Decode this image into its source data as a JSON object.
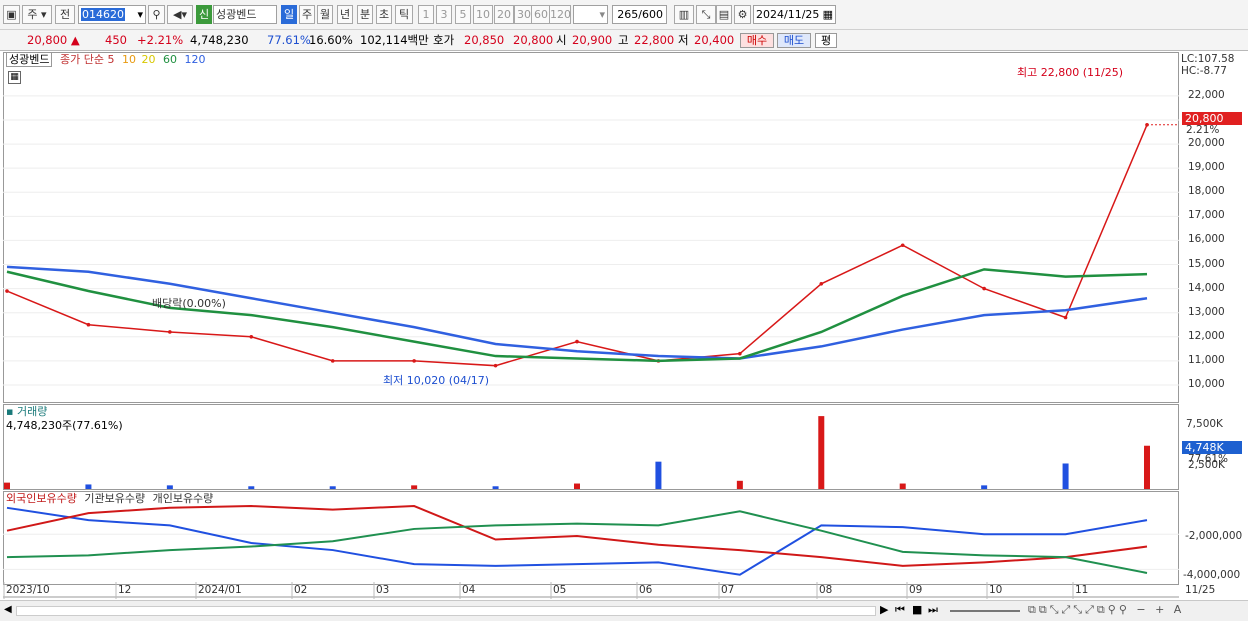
{
  "toolbar": {
    "market_type": "주",
    "prev_label": "전",
    "stock_code": "014620",
    "stock_badge": "신",
    "stock_name": "성광벤드",
    "periods": [
      "일",
      "주",
      "월",
      "년",
      "분",
      "초",
      "틱"
    ],
    "active_period": "일",
    "intervals": [
      "1",
      "3",
      "5",
      "10",
      "20",
      "30",
      "60",
      "120"
    ],
    "count": "265",
    "count_total": "/600",
    "date": "2024/11/25"
  },
  "quote": {
    "price": "20,800",
    "change": "450",
    "change_pct": "+2.21%",
    "volume": "4,748,230",
    "vol_ratio": "77.61%",
    "turnover": "16.60%",
    "amount": "102,114백만",
    "bid_label": "호가",
    "bid": "20,850",
    "ask": "20,800",
    "open_label": "시",
    "open": "20,900",
    "high_label": "고",
    "high": "22,800",
    "low_label": "저",
    "low": "20,400",
    "buy_label": "매수",
    "sell_label": "매도",
    "avg_label": "평"
  },
  "price_panel": {
    "legend_name": "성광벤드",
    "legend_ma_label": "종가 단순",
    "ma_periods": [
      "5",
      "10",
      "20",
      "60",
      "120"
    ],
    "ma_colors": [
      "#e02020",
      "#f0a020",
      "#f0e020",
      "#20a040",
      "#3060e0"
    ],
    "top_right_lc": "LC:107.58",
    "top_right_hc": "HC:-8.77",
    "current_price_tag": "20,800",
    "current_pct_tag": "2.21%",
    "high_annotation": "최고 22,800 (11/25)",
    "low_annotation": "최저 10,020 (04/17)",
    "dividend_annotation": "배당락(0.00%)",
    "y_ticks": [
      "22,000",
      "21,000",
      "20,000",
      "19,000",
      "18,000",
      "17,000",
      "16,000",
      "15,000",
      "14,000",
      "13,000",
      "12,000",
      "11,000",
      "10,000"
    ]
  },
  "volume_panel": {
    "title": "거래량",
    "value_label": "4,748,230주(77.61%)",
    "y_ticks": [
      "7,500K",
      "2,500K"
    ],
    "current_tag": "4,748K",
    "current_pct": "77.61%"
  },
  "holdings_panel": {
    "legend": [
      "외국인보유수량",
      "기관보유수량",
      "개인보유수량"
    ],
    "colors": [
      "#2050e0",
      "#d01818",
      "#209050"
    ],
    "y_ticks": [
      "-2,000,000",
      "-4,000,000"
    ]
  },
  "x_axis": [
    "2023/10",
    "12",
    "2024/01",
    "02",
    "03",
    "04",
    "05",
    "06",
    "07",
    "08",
    "09",
    "10",
    "11",
    "11/25"
  ],
  "chart_data": {
    "type": "line",
    "title": "성광벤드",
    "xlabel": "",
    "ylabel": "",
    "x": [
      "2023/10",
      "11",
      "12",
      "2024/01",
      "02",
      "03",
      "04",
      "05",
      "06",
      "07",
      "08",
      "09",
      "10",
      "11",
      "11/25"
    ],
    "series": [
      {
        "name": "종가",
        "values": [
          13900,
          12500,
          12200,
          12000,
          11000,
          11000,
          10800,
          11800,
          11000,
          11300,
          14200,
          15800,
          14000,
          12800,
          20800
        ]
      },
      {
        "name": "120",
        "values": [
          14900,
          14700,
          14200,
          13600,
          13000,
          12400,
          11700,
          11400,
          11200,
          11100,
          11600,
          12300,
          12900,
          13100,
          13600
        ]
      },
      {
        "name": "60",
        "values": [
          14700,
          13900,
          13200,
          12900,
          12400,
          11800,
          11200,
          11100,
          11000,
          11100,
          12200,
          13700,
          14800,
          14500,
          14600
        ]
      }
    ],
    "ylim": [
      10000,
      22800
    ],
    "volume": {
      "values_k": [
        700,
        500,
        400,
        300,
        300,
        400,
        300,
        600,
        3000,
        900,
        8000,
        600,
        400,
        2800,
        4748
      ]
    },
    "holdings": {
      "series": [
        {
          "name": "외국인보유수량",
          "values": [
            -500000,
            -1200000,
            -1500000,
            -2500000,
            -2900000,
            -3700000,
            -3800000,
            -3700000,
            -3600000,
            -4300000,
            -1500000,
            -1600000,
            -2000000,
            -2000000,
            -1200000
          ]
        },
        {
          "name": "기관보유수량",
          "values": [
            -1800000,
            -800000,
            -500000,
            -400000,
            -600000,
            -400000,
            -2300000,
            -2100000,
            -2600000,
            -2900000,
            -3300000,
            -3800000,
            -3600000,
            -3300000,
            -2700000
          ]
        },
        {
          "name": "개인보유수량",
          "values": [
            -3300000,
            -3200000,
            -2900000,
            -2700000,
            -2400000,
            -1700000,
            -1500000,
            -1400000,
            -1500000,
            -700000,
            -1800000,
            -3000000,
            -3200000,
            -3300000,
            -4200000
          ]
        }
      ]
    }
  }
}
